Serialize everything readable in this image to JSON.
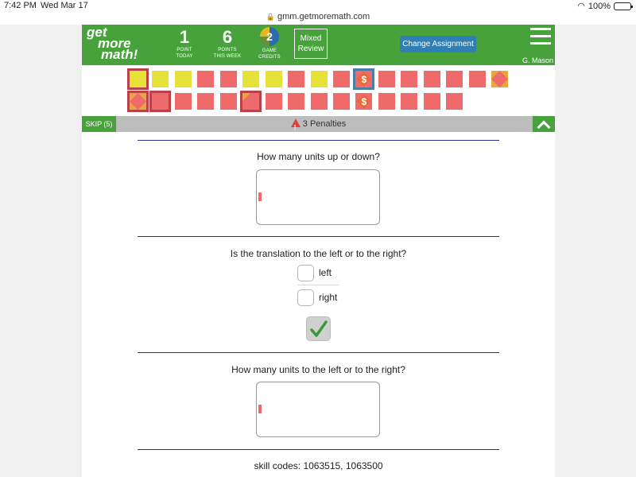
{
  "status_bar": {
    "time": "7:42 PM",
    "date": "Wed Mar 17",
    "battery": "100%"
  },
  "browser": {
    "url": "gmm.getmoremath.com"
  },
  "header": {
    "logo": [
      "get",
      "more",
      "math!"
    ],
    "stats": [
      {
        "value": "1",
        "label_1": "POINT",
        "label_2": "TODAY"
      },
      {
        "value": "6",
        "label_1": "POINTS",
        "label_2": "THIS WEEK"
      },
      {
        "value": "2",
        "label_1": "GAME",
        "label_2": "CREDITS"
      }
    ],
    "mixed_review": [
      "Mixed",
      "Review"
    ],
    "change_assignment": "Change Assignment",
    "user": "G. Mason"
  },
  "tiles": {
    "row1": [
      "yellow-current",
      "yellow",
      "yellow",
      "red",
      "red",
      "yellow",
      "yellow",
      "red",
      "yellow",
      "red",
      "dollar-selected",
      "red",
      "red",
      "red",
      "red",
      "red",
      "diamond"
    ],
    "row2": [
      "diamond-outlined",
      "red-outlined",
      "red",
      "red",
      "red",
      "red-corner-outlined",
      "red",
      "red",
      "red",
      "red",
      "dollar",
      "red",
      "red",
      "red",
      "red"
    ]
  },
  "toolbar": {
    "skip": "SKIP (5)",
    "penalties": "3 Penalties"
  },
  "questions": [
    {
      "text": "How many units up or down?",
      "answer": ""
    },
    {
      "text": "Is the translation to the left or to the right?",
      "options": [
        "left",
        "right"
      ]
    },
    {
      "text": "How many units to the left or to the right?",
      "answer": ""
    }
  ],
  "footer": {
    "skill_codes": "skill codes: 1063515, 1063500"
  }
}
